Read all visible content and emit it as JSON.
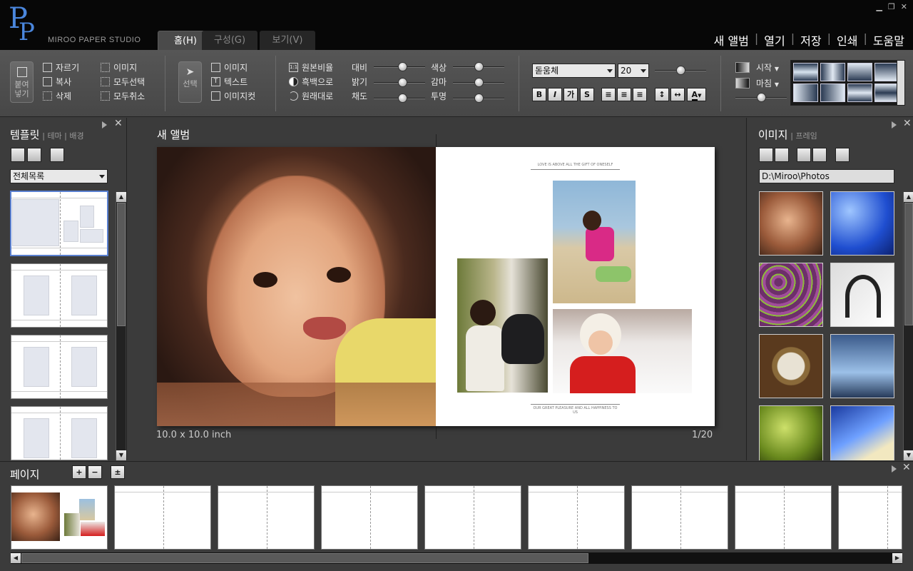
{
  "app": {
    "logo_text": "Paper",
    "brand": "MIROO PAPER STUDIO",
    "tabs": [
      "홈(H)",
      "구성(G)",
      "보기(V)"
    ],
    "top_menu": [
      "새 앨범",
      "열기",
      "저장",
      "인쇄",
      "도움말"
    ],
    "window_controls": [
      "minimize-icon",
      "restore-icon",
      "close-icon"
    ]
  },
  "ribbon": {
    "paste_label": "붙여\n넣기",
    "edit": [
      "자르기",
      "복사",
      "삭제"
    ],
    "select_group": [
      "이미지",
      "모두선택",
      "모두취소"
    ],
    "select_label": "선택",
    "insert": [
      "이미지",
      "텍스트",
      "이미지컷"
    ],
    "image_ops": [
      "원본비율",
      "흑백으로",
      "원래대로"
    ],
    "adjust_left": [
      "대비",
      "밝기",
      "채도"
    ],
    "adjust_right": [
      "색상",
      "감마",
      "투명"
    ],
    "adjust_left_levels": [
      0.55,
      0.55,
      0.55
    ],
    "adjust_right_levels": [
      0.5,
      0.5,
      0.5
    ],
    "font_name": "돋움체",
    "font_size": "20",
    "font_slider_level": 0.5,
    "format_buttons": [
      "B",
      "I",
      "가",
      "S"
    ],
    "gradient": [
      "시작",
      "마침"
    ],
    "gradient_slider_level": 0.5
  },
  "left_panel": {
    "title": "템플릿",
    "subtabs": [
      "테마",
      "배경"
    ],
    "filter_value": "전체목록"
  },
  "main": {
    "album_title": "새 앨범",
    "top_caption": "LOVE IS ABOVE ALL THE GIFT OF ONESELF",
    "bottom_caption": "OUR GREAT PLEASURE AND ALL HAPPINESS TO US",
    "size": "10.0 x 10.0 inch",
    "page_indicator": "1/20"
  },
  "right_panel": {
    "title": "이미지",
    "subtab": "프레임",
    "path": "D:\\Miroo\\Photos",
    "images": [
      "girl-portrait",
      "blue-abstract",
      "purple-flowers",
      "headphones",
      "compass",
      "tv-sets",
      "green-leaves",
      "blue-device"
    ]
  },
  "page_panel": {
    "title": "페이지",
    "count": 9
  }
}
